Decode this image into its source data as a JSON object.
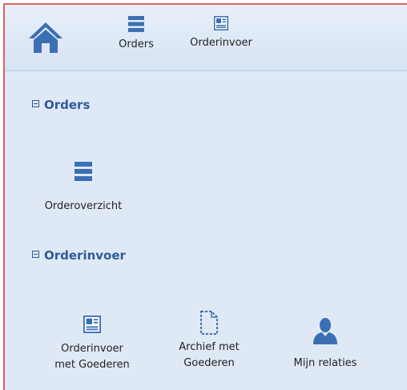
{
  "topbar": {
    "home_icon": "home-icon",
    "buttons": [
      {
        "label": "Orders",
        "icon": "list-icon"
      },
      {
        "label": "Orderinvoer",
        "icon": "form-icon"
      }
    ]
  },
  "sections": [
    {
      "title": "Orders",
      "items": [
        {
          "label": "Orderoverzicht",
          "icon": "list-icon"
        }
      ]
    },
    {
      "title": "Orderinvoer",
      "items": [
        {
          "label_line1": "Orderinvoer",
          "label_line2": "met Goederen",
          "icon": "form-icon"
        },
        {
          "label_line1": "Archief met",
          "label_line2": "Goederen",
          "icon": "document-outline-icon"
        },
        {
          "label_line1": "Mijn relaties",
          "label_line2": "",
          "icon": "user-icon"
        }
      ]
    }
  ],
  "colors": {
    "accent": "#2f5a9a",
    "icon": "#3b6fb3",
    "panel_bg": "#dfe9f5",
    "border": "#e06060"
  }
}
